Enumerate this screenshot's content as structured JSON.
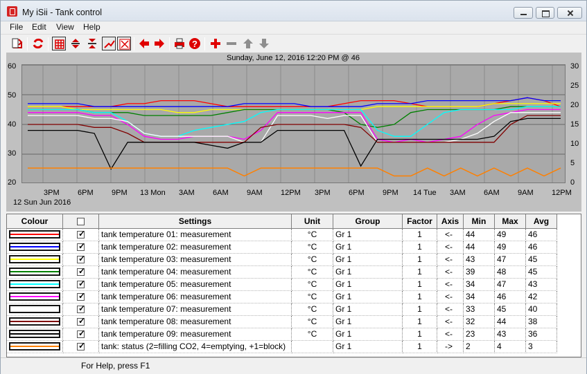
{
  "window": {
    "title": "My iSii - Tank control"
  },
  "menu": [
    "File",
    "Edit",
    "View",
    "Help"
  ],
  "toolbar": {
    "icons": [
      "export-icon",
      "refresh-icon",
      "grid-icon",
      "expand-vertical-icon",
      "compress-vertical-icon",
      "trend-icon",
      "cancel-icon",
      "left-arrow-icon",
      "right-arrow-icon",
      "print-icon",
      "help-icon",
      "add-icon",
      "remove-icon",
      "up-icon",
      "down-icon"
    ]
  },
  "chart": {
    "header": "Sunday, June 12, 2016 12:20 PM @ 46",
    "date_label": "12 Sun Jun 2016"
  },
  "chart_data": {
    "type": "line",
    "title": "Sunday, June 12, 2016 12:20 PM @ 46",
    "xlabel": "",
    "ylabel": "",
    "ylim": [
      20,
      60
    ],
    "y2lim": [
      0,
      30
    ],
    "x_ticks": [
      "3PM",
      "6PM",
      "9PM",
      "13 Mon",
      "3AM",
      "6AM",
      "9AM",
      "12PM",
      "3PM",
      "6PM",
      "9PM",
      "14 Tue",
      "3AM",
      "6AM",
      "9AM",
      "12PM"
    ],
    "left_y_ticks": [
      20,
      30,
      40,
      50,
      60
    ],
    "right_y_ticks": [
      0,
      5,
      10,
      15,
      20,
      25,
      30
    ],
    "grid": true,
    "series": [
      {
        "name": "tank temperature 01: measurement",
        "color": "#ff0000",
        "values": [
          46,
          46,
          46,
          46,
          46,
          46,
          47,
          47,
          48,
          48,
          48,
          47,
          46,
          46,
          46,
          46,
          46,
          46,
          46,
          47,
          48,
          48,
          48,
          47,
          46,
          46,
          46,
          46,
          47,
          48,
          49,
          48,
          46
        ]
      },
      {
        "name": "tank temperature 02: measurement",
        "color": "#0000ff",
        "values": [
          47,
          47,
          47,
          47,
          46,
          46,
          46,
          46,
          46,
          46,
          46,
          46,
          46,
          47,
          47,
          47,
          47,
          46,
          46,
          46,
          46,
          47,
          47,
          47,
          48,
          48,
          48,
          48,
          48,
          48,
          49,
          48,
          48
        ]
      },
      {
        "name": "tank temperature 03: measurement",
        "color": "#ffff00",
        "values": [
          46,
          46,
          46,
          45,
          45,
          45,
          45,
          45,
          45,
          44,
          44,
          45,
          45,
          45,
          45,
          45,
          45,
          45,
          45,
          45,
          45,
          46,
          46,
          46,
          46,
          46,
          46,
          46,
          47,
          47,
          47,
          47,
          47
        ]
      },
      {
        "name": "tank temperature 04: measurement",
        "color": "#008000",
        "values": [
          45,
          45,
          45,
          45,
          44,
          44,
          44,
          43,
          43,
          43,
          43,
          43,
          44,
          45,
          45,
          45,
          45,
          45,
          45,
          44,
          40,
          39,
          40,
          44,
          45,
          45,
          45,
          45,
          45,
          46,
          46,
          46,
          46
        ]
      },
      {
        "name": "tank temperature 05: measurement",
        "color": "#00ffff",
        "values": [
          45,
          45,
          45,
          45,
          44,
          44,
          41,
          37,
          36,
          36,
          38,
          39,
          40,
          41,
          44,
          45,
          45,
          45,
          45,
          45,
          45,
          38,
          36,
          36,
          40,
          44,
          45,
          45,
          45,
          45,
          46,
          46,
          46
        ]
      },
      {
        "name": "tank temperature 06: measurement",
        "color": "#ff00ff",
        "values": [
          44,
          44,
          44,
          44,
          43,
          43,
          40,
          36,
          35,
          35,
          36,
          36,
          36,
          35,
          38,
          44,
          44,
          44,
          44,
          44,
          44,
          35,
          34,
          35,
          34,
          35,
          36,
          40,
          43,
          44,
          45,
          45,
          45
        ]
      },
      {
        "name": "tank temperature 07: measurement",
        "color": "#ffffff",
        "values": [
          43,
          43,
          43,
          43,
          42,
          42,
          41,
          37,
          36,
          36,
          36,
          36,
          36,
          34,
          34,
          43,
          43,
          43,
          42,
          43,
          43,
          34,
          34,
          34,
          34,
          34,
          35,
          37,
          41,
          44,
          44,
          44,
          44
        ]
      },
      {
        "name": "tank temperature 08: measurement",
        "color": "#800000",
        "values": [
          40,
          40,
          40,
          40,
          39,
          39,
          37,
          34,
          34,
          34,
          34,
          34,
          34,
          34,
          39,
          40,
          40,
          40,
          40,
          40,
          39,
          34,
          34,
          34,
          34,
          34,
          34,
          34,
          34,
          40,
          43,
          43,
          43
        ]
      },
      {
        "name": "tank temperature 09: measurement",
        "color": "#000000",
        "values": [
          38,
          38,
          38,
          38,
          37,
          25,
          34,
          34,
          34,
          34,
          34,
          33,
          32,
          34,
          34,
          38,
          38,
          38,
          38,
          38,
          26,
          35,
          35,
          35,
          35,
          35,
          35,
          35,
          36,
          41,
          42,
          42,
          42
        ]
      },
      {
        "name": "tank: status (2=filling CO2, 4=emptying, +1=block)",
        "color": "#ff8000",
        "axis": "right",
        "values": [
          4,
          4,
          4,
          4,
          4,
          4,
          4,
          4,
          4,
          4,
          4,
          4,
          4,
          2,
          4,
          4,
          4,
          4,
          4,
          4,
          4,
          4,
          2,
          2,
          4,
          2,
          4,
          2,
          4,
          2,
          4,
          2,
          4
        ]
      }
    ]
  },
  "table": {
    "headers": [
      "Colour",
      "",
      "Settings",
      "Unit",
      "Group",
      "Factor",
      "Axis",
      "Min",
      "Max",
      "Avg"
    ],
    "rows": [
      {
        "color": "#ff0000",
        "checked": true,
        "settings": "tank temperature 01: measurement",
        "unit": "°C",
        "group": "Gr 1",
        "factor": "1",
        "axis": "<-",
        "min": "44",
        "max": "49",
        "avg": "46"
      },
      {
        "color": "#0000ff",
        "checked": true,
        "settings": "tank temperature 02: measurement",
        "unit": "°C",
        "group": "Gr 1",
        "factor": "1",
        "axis": "<-",
        "min": "44",
        "max": "49",
        "avg": "46"
      },
      {
        "color": "#ffff00",
        "checked": true,
        "settings": "tank temperature 03: measurement",
        "unit": "°C",
        "group": "Gr 1",
        "factor": "1",
        "axis": "<-",
        "min": "43",
        "max": "47",
        "avg": "45"
      },
      {
        "color": "#008000",
        "checked": true,
        "settings": "tank temperature 04: measurement",
        "unit": "°C",
        "group": "Gr 1",
        "factor": "1",
        "axis": "<-",
        "min": "39",
        "max": "48",
        "avg": "45"
      },
      {
        "color": "#00ffff",
        "checked": true,
        "settings": "tank temperature 05: measurement",
        "unit": "°C",
        "group": "Gr 1",
        "factor": "1",
        "axis": "<-",
        "min": "34",
        "max": "47",
        "avg": "43"
      },
      {
        "color": "#ff00ff",
        "checked": true,
        "settings": "tank temperature 06: measurement",
        "unit": "°C",
        "group": "Gr 1",
        "factor": "1",
        "axis": "<-",
        "min": "34",
        "max": "46",
        "avg": "42"
      },
      {
        "color": "#ffffff",
        "checked": true,
        "settings": "tank temperature 07: measurement",
        "unit": "°C",
        "group": "Gr 1",
        "factor": "1",
        "axis": "<-",
        "min": "33",
        "max": "45",
        "avg": "40"
      },
      {
        "color": "#800000",
        "checked": true,
        "settings": "tank temperature 08: measurement",
        "unit": "°C",
        "group": "Gr 1",
        "factor": "1",
        "axis": "<-",
        "min": "32",
        "max": "44",
        "avg": "38"
      },
      {
        "color": "#000000",
        "checked": true,
        "settings": "tank temperature 09: measurement",
        "unit": "°C",
        "group": "Gr 1",
        "factor": "1",
        "axis": "<-",
        "min": "23",
        "max": "43",
        "avg": "36"
      },
      {
        "color": "#ff8000",
        "checked": true,
        "settings": "tank: status (2=filling CO2, 4=emptying, +1=block)",
        "unit": "",
        "group": "Gr 1",
        "factor": "1",
        "axis": "->",
        "min": "2",
        "max": "4",
        "avg": "3"
      }
    ]
  },
  "status": {
    "text": "For Help, press F1"
  }
}
